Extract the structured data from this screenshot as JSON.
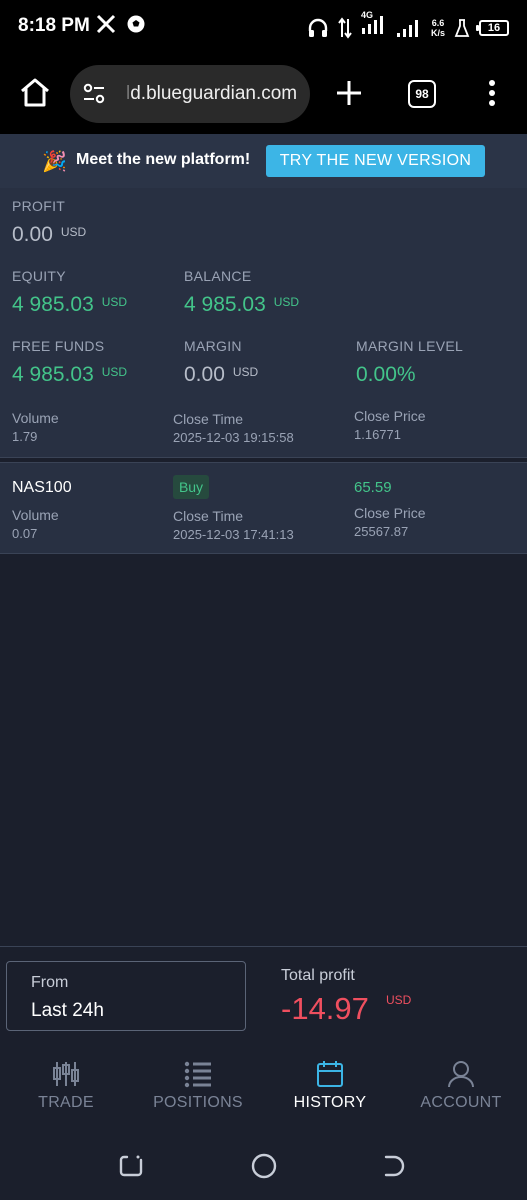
{
  "status_bar": {
    "time": "8:18 PM",
    "network_label": "4G",
    "speed_top": "6.6",
    "speed_bottom": "K/s",
    "battery": "16",
    "icons": [
      "x-logo-icon",
      "football-icon",
      "headphones-icon",
      "data-arrows-icon",
      "signal-icon",
      "signal-icon",
      "flask-icon",
      "battery-icon"
    ]
  },
  "browser": {
    "url_faded": "l",
    "url": "d.blueguardian.com",
    "tab_count": "98",
    "icons": [
      "home-icon",
      "site-settings-icon",
      "plus-icon",
      "more-vert-icon"
    ]
  },
  "banner": {
    "emoji": "🎉",
    "message": "Meet the new platform!",
    "button": "TRY THE NEW VERSION"
  },
  "account": {
    "profit": {
      "label": "PROFIT",
      "value": "0.00",
      "currency": "USD"
    },
    "equity": {
      "label": "EQUITY",
      "value": "4 985.03",
      "currency": "USD"
    },
    "balance": {
      "label": "BALANCE",
      "value": "4 985.03",
      "currency": "USD"
    },
    "free_funds": {
      "label": "FREE FUNDS",
      "value": "4 985.03",
      "currency": "USD"
    },
    "margin": {
      "label": "MARGIN",
      "value": "0.00",
      "currency": "USD"
    },
    "margin_level": {
      "label": "MARGIN LEVEL",
      "value": "0.00%"
    }
  },
  "trades": [
    {
      "volume_label": "Volume",
      "volume": "1.79",
      "close_time_label": "Close Time",
      "close_time": "2025-12-03 19:15:58",
      "close_price_label": "Close Price",
      "close_price": "1.16771"
    },
    {
      "symbol": "NAS100",
      "side": "Buy",
      "profit": "65.59",
      "volume_label": "Volume",
      "volume": "0.07",
      "close_time_label": "Close Time",
      "close_time": "2025-12-03 17:41:13",
      "close_price_label": "Close Price",
      "close_price": "25567.87"
    }
  ],
  "summary": {
    "from_label": "From",
    "from_value": "Last 24h",
    "total_label": "Total profit",
    "total_value": "-14.97",
    "total_currency": "USD"
  },
  "nav": [
    {
      "label": "TRADE",
      "icon": "candlestick-icon",
      "active": false
    },
    {
      "label": "POSITIONS",
      "icon": "list-icon",
      "active": false
    },
    {
      "label": "HISTORY",
      "icon": "calendar-icon",
      "active": true
    },
    {
      "label": "ACCOUNT",
      "icon": "user-icon",
      "active": false
    }
  ],
  "colors": {
    "background": "#1b1f2c",
    "panel": "#283042",
    "positive": "#43c48a",
    "negative": "#ef4f5f",
    "accent": "#3cb5e6"
  }
}
